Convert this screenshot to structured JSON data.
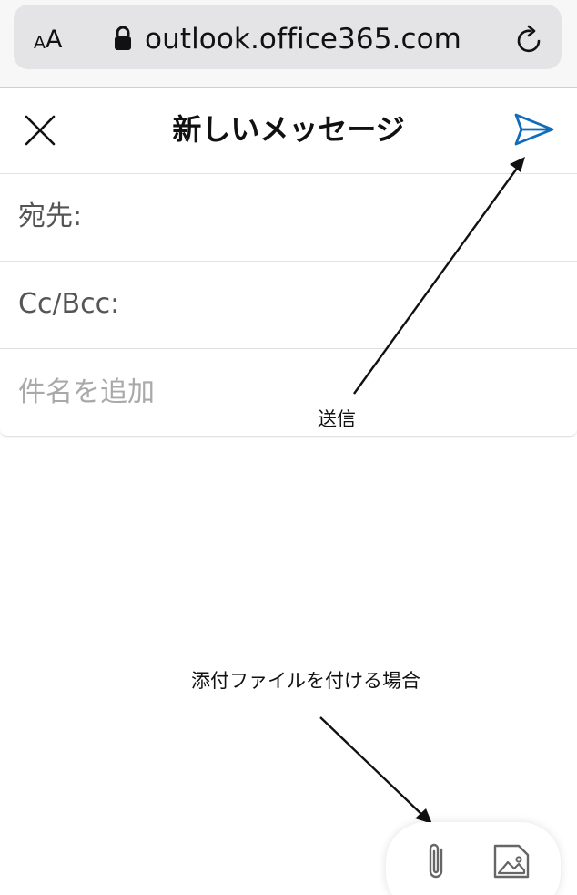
{
  "browser": {
    "text_size_small": "A",
    "text_size_big": "A",
    "url": "outlook.office365.com",
    "icons": [
      "lock-icon",
      "reload-icon"
    ]
  },
  "compose": {
    "title": "新しいメッセージ",
    "to_label": "宛先:",
    "cc_label": "Cc/Bcc:",
    "subject_placeholder": "件名を追加",
    "icons": [
      "close-icon",
      "send-icon",
      "paperclip-icon",
      "image-icon"
    ],
    "accent_color": "#0f6cbd"
  },
  "annotations": {
    "send": "送信",
    "attach": "添付ファイルを付ける場合"
  }
}
